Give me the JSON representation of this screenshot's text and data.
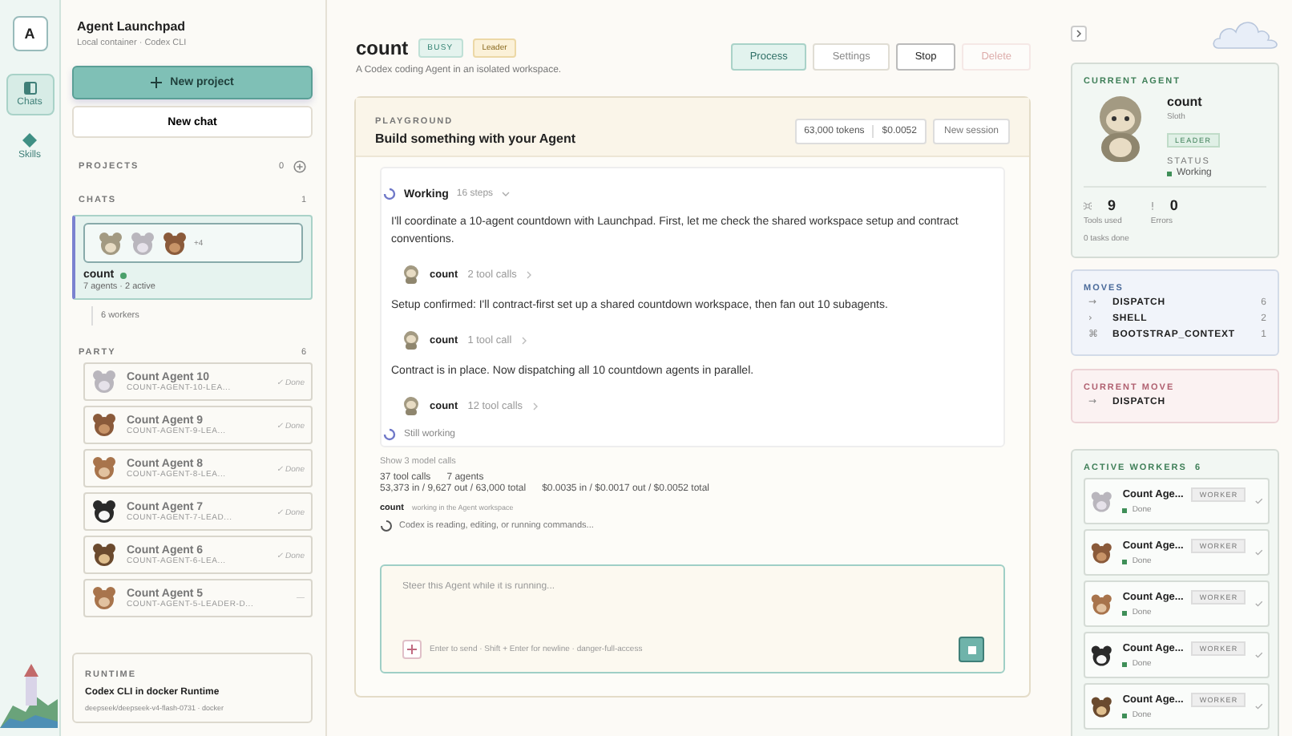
{
  "rail": {
    "avatar": "A",
    "items": [
      {
        "label": "Chats",
        "selected": true,
        "kind": "chats"
      },
      {
        "label": "Skills",
        "selected": false,
        "kind": "skills"
      }
    ]
  },
  "sidebar": {
    "title": "Agent Launchpad",
    "subtitle": "Local container · Codex CLI",
    "new_project": "New project",
    "new_chat": "New chat",
    "projects": {
      "label": "PROJECTS",
      "count": "0"
    },
    "chats": {
      "label": "CHATS",
      "count": "1",
      "items": [
        {
          "name": "count",
          "subtitle": "7 agents · 2 active",
          "more": "+4",
          "selected": true,
          "avatars": [
            {
              "kind": "sloth"
            },
            {
              "kind": "koala"
            },
            {
              "kind": "bear"
            }
          ]
        }
      ]
    },
    "workers_toggle": "6 workers",
    "party": {
      "label": "PARTY",
      "count": "6",
      "items": [
        {
          "name": "Count Agent 10",
          "id": "COUNT-AGENT-10-LEA...",
          "status": "✓ Done",
          "kind": "koala"
        },
        {
          "name": "Count Agent 9",
          "id": "COUNT-AGENT-9-LEA...",
          "status": "✓ Done",
          "kind": "bear"
        },
        {
          "name": "Count Agent 8",
          "id": "COUNT-AGENT-8-LEA...",
          "status": "✓ Done",
          "kind": "otter"
        },
        {
          "name": "Count Agent 7",
          "id": "COUNT-AGENT-7-LEAD...",
          "status": "✓ Done",
          "kind": "panda"
        },
        {
          "name": "Count Agent 6",
          "id": "COUNT-AGENT-6-LEA...",
          "status": "✓ Done",
          "kind": "hedgehog"
        },
        {
          "name": "Count Agent 5",
          "id": "COUNT-AGENT-5-LEADER-D...",
          "status": "—",
          "kind": "otter"
        }
      ]
    },
    "runtime": {
      "label": "RUNTIME",
      "title": "Codex CLI in docker Runtime",
      "detail": "deepseek/deepseek-v4-flash-0731 · docker"
    }
  },
  "header": {
    "title": "count",
    "badges": [
      {
        "label": "BUSY",
        "kind": "status"
      },
      {
        "label": "Leader",
        "kind": "role"
      }
    ],
    "subtitle": "A Codex coding Agent in an isolated workspace.",
    "actions": [
      {
        "label": "Process",
        "kind": "primary",
        "disabled": false
      },
      {
        "label": "Settings",
        "kind": "plain",
        "disabled": false
      },
      {
        "label": "Stop",
        "kind": "strong",
        "disabled": false
      },
      {
        "label": "Delete",
        "kind": "danger",
        "disabled": true
      }
    ]
  },
  "playground": {
    "eyebrow": "PLAYGROUND",
    "title": "Build something with your Agent",
    "tokens": "63,000 tokens",
    "cost": "$0.0052",
    "new_session": "New session",
    "working": {
      "label": "Working",
      "steps": "16 steps"
    },
    "messages": [
      {
        "kind": "text",
        "text": "I'll coordinate a 10-agent countdown with Launchpad. First, let me check the shared workspace setup and contract conventions."
      },
      {
        "kind": "tool",
        "name": "count",
        "calls": "2 tool calls"
      },
      {
        "kind": "text",
        "text": "Setup confirmed: I'll contract-first set up a shared countdown workspace, then fan out 10 subagents."
      },
      {
        "kind": "tool",
        "name": "count",
        "calls": "1 tool call"
      },
      {
        "kind": "text",
        "text": "Contract is in place. Now dispatching all 10 countdown agents in parallel."
      },
      {
        "kind": "tool",
        "name": "count",
        "calls": "12 tool calls"
      }
    ],
    "still": "Still working",
    "show_calls": "Show 3 model calls",
    "tool_calls": "37 tool calls",
    "agents": "7 agents",
    "tokens_line": "53,373 in / 9,627 out / 63,000 total",
    "cost_line": "$0.0035 in / $0.0017 out / $0.0052 total",
    "agent_name": "count",
    "agent_note": "working in the Agent workspace",
    "activity": "Codex is reading, editing, or running commands...",
    "composer": {
      "placeholder": "Steer this Agent while it is running...",
      "hint": "Enter to send · Shift + Enter for newline · danger-full-access"
    }
  },
  "right": {
    "current_agent": {
      "label": "CURRENT AGENT",
      "name": "count",
      "species": "Sloth",
      "role": "LEADER",
      "status_label": "STATUS",
      "status": "Working",
      "tools": "9",
      "tools_label": "Tools used",
      "errors": "0",
      "errors_label": "Errors",
      "tasks": "0 tasks done"
    },
    "moves": {
      "label": "MOVES",
      "items": [
        {
          "name": "DISPATCH",
          "count": "6",
          "icon": "→"
        },
        {
          "name": "SHELL",
          "count": "2",
          "icon": "›"
        },
        {
          "name": "BOOTSTRAP_CONTEXT",
          "count": "1",
          "icon": "⌘"
        }
      ]
    },
    "current_move": {
      "label": "CURRENT MOVE",
      "icon": "→",
      "name": "DISPATCH"
    },
    "active_workers": {
      "label": "ACTIVE WORKERS",
      "count": "6",
      "items": [
        {
          "name": "Count Age...",
          "role": "WORKER",
          "status": "Done",
          "kind": "koala"
        },
        {
          "name": "Count Age...",
          "role": "WORKER",
          "status": "Done",
          "kind": "bear"
        },
        {
          "name": "Count Age...",
          "role": "WORKER",
          "status": "Done",
          "kind": "otter"
        },
        {
          "name": "Count Age...",
          "role": "WORKER",
          "status": "Done",
          "kind": "panda"
        },
        {
          "name": "Count Age...",
          "role": "WORKER",
          "status": "Done",
          "kind": "hedgehog"
        }
      ]
    }
  }
}
